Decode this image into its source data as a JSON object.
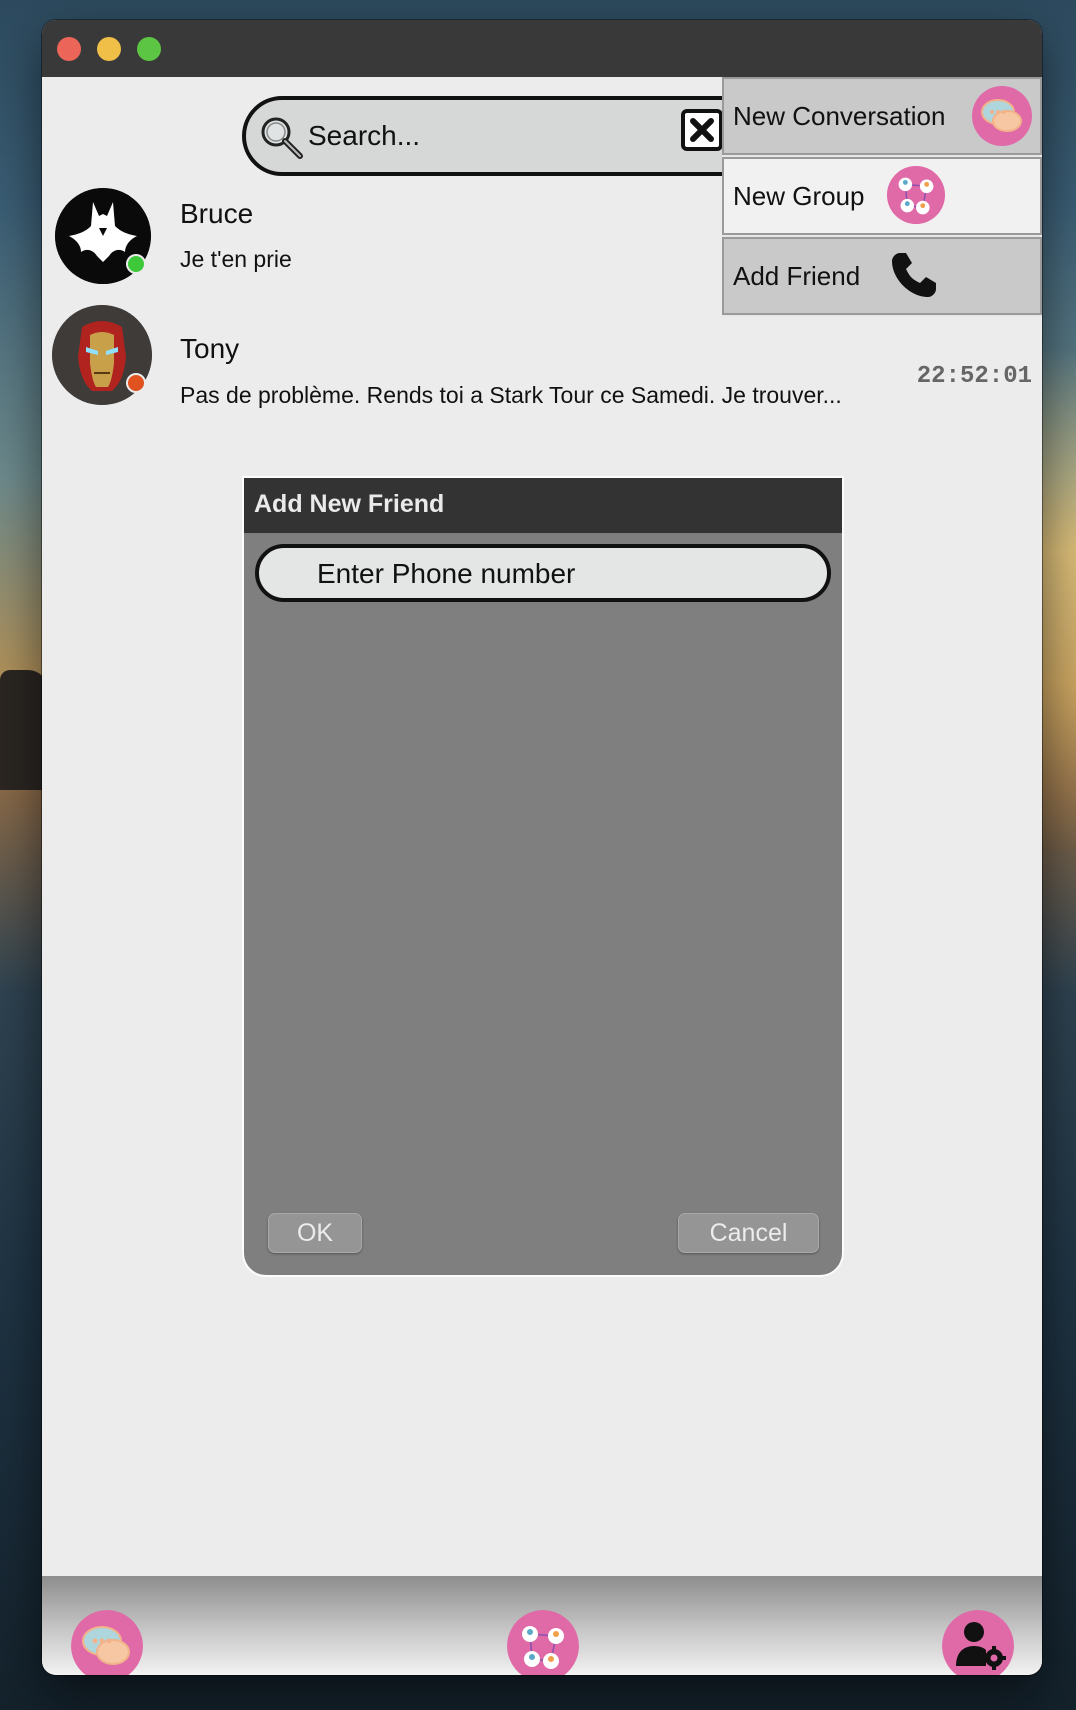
{
  "search": {
    "placeholder": "Search..."
  },
  "conversations": [
    {
      "name": "Bruce",
      "last_message": "Je t'en prie",
      "time": "",
      "status_color": "#3ec93a"
    },
    {
      "name": "Tony",
      "last_message": "Pas de problème. Rends toi a Stark Tour ce Samedi. Je trouver...",
      "time": "22:52:01",
      "status_color": "#e0521f"
    }
  ],
  "menu": {
    "items": [
      {
        "label": "New Conversation",
        "icon": "chat-bubbles-icon"
      },
      {
        "label": "New Group",
        "icon": "group-network-icon"
      },
      {
        "label": "Add Friend",
        "icon": "phone-icon"
      }
    ]
  },
  "dialog": {
    "title": "Add New Friend",
    "phone_placeholder": "Enter Phone number",
    "ok_label": "OK",
    "cancel_label": "Cancel"
  },
  "bottom_nav": {
    "items": [
      {
        "icon": "chat-bubbles-icon"
      },
      {
        "icon": "group-network-icon"
      },
      {
        "icon": "user-settings-icon"
      }
    ]
  },
  "colors": {
    "accent_pink": "#e06aa8",
    "titlebar": "#393939",
    "dialog_body": "#7f7f7f"
  }
}
